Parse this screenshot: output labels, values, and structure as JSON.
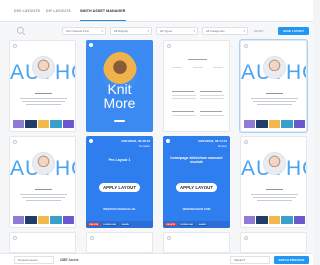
{
  "tabs": [
    {
      "label": "DIVI LAYOUTS",
      "active": false
    },
    {
      "label": "DIY LAYOUTS",
      "active": false
    },
    {
      "label": "SMITH ASSET MANAGER",
      "active": true
    }
  ],
  "filters": {
    "post": "Sort Newest First",
    "display": "All Display",
    "types": "All Types",
    "categories": "All Categories",
    "reset": "RESET",
    "save_label": "SAVE LAYOUT"
  },
  "cards": {
    "author_text": "AUTHOR",
    "knit_line1": "Knit",
    "knit_line2": "More",
    "layout1": {
      "date": "03/04/2024, 06:38:19",
      "type": "Template",
      "title": "Pro Layout 1",
      "apply": "APPLY LAYOUT",
      "site": "WEBTOOLSMANUAL.NL",
      "actions": [
        "DELETE",
        "DOWNLOAD",
        "SHARE"
      ]
    },
    "layout2": {
      "date": "03/04/2024, 06:14:13",
      "type": "Module",
      "title": "homepage slideshow carousel module",
      "apply": "APPLY LAYOUT",
      "site": "WEBSMASHER.COM",
      "actions": [
        "DELETE",
        "DOWNLOAD",
        "SHARE"
      ]
    }
  },
  "footer": {
    "per_page": "Newest Assets",
    "count_number": "1357",
    "count_label": "Assets",
    "bulk": "SELECT",
    "batch_label": "BATCH PROCESS"
  },
  "colors": {
    "accent": "#2196f3",
    "card_blue": "#2f7ef0",
    "author_blue": "#4aa3f0"
  }
}
